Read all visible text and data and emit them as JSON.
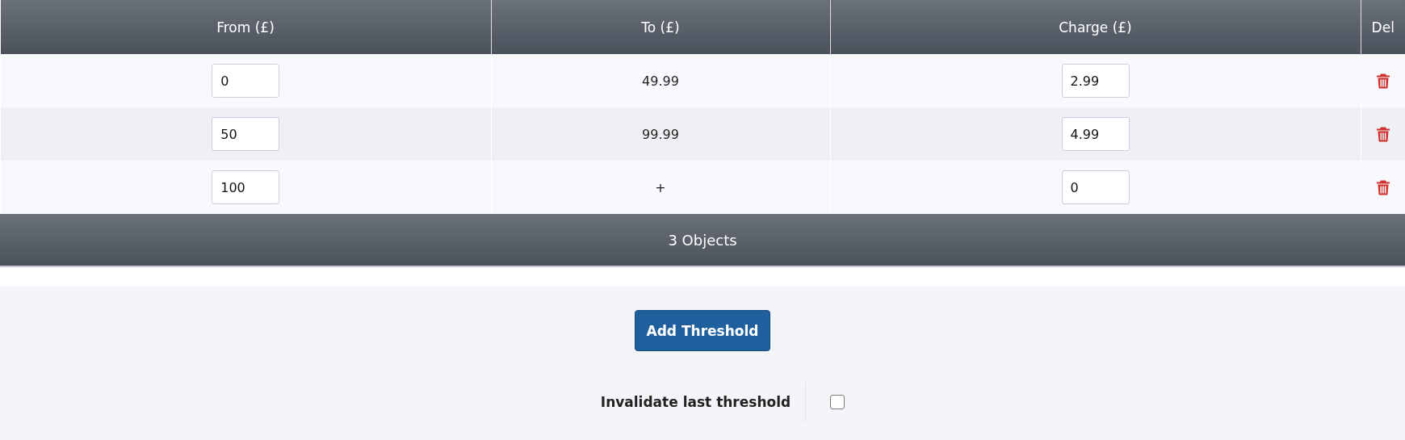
{
  "table": {
    "columns": [
      "From (£)",
      "To (£)",
      "Charge (£)",
      "Del"
    ],
    "rows": [
      {
        "from": "0",
        "to": "49.99",
        "charge": "2.99"
      },
      {
        "from": "50",
        "to": "99.99",
        "charge": "4.99"
      },
      {
        "from": "100",
        "to": "+",
        "charge": "0"
      }
    ],
    "footer": "3 Objects"
  },
  "add_button": "Add Threshold",
  "invalidate": {
    "label": "Invalidate last threshold",
    "checked": false
  }
}
